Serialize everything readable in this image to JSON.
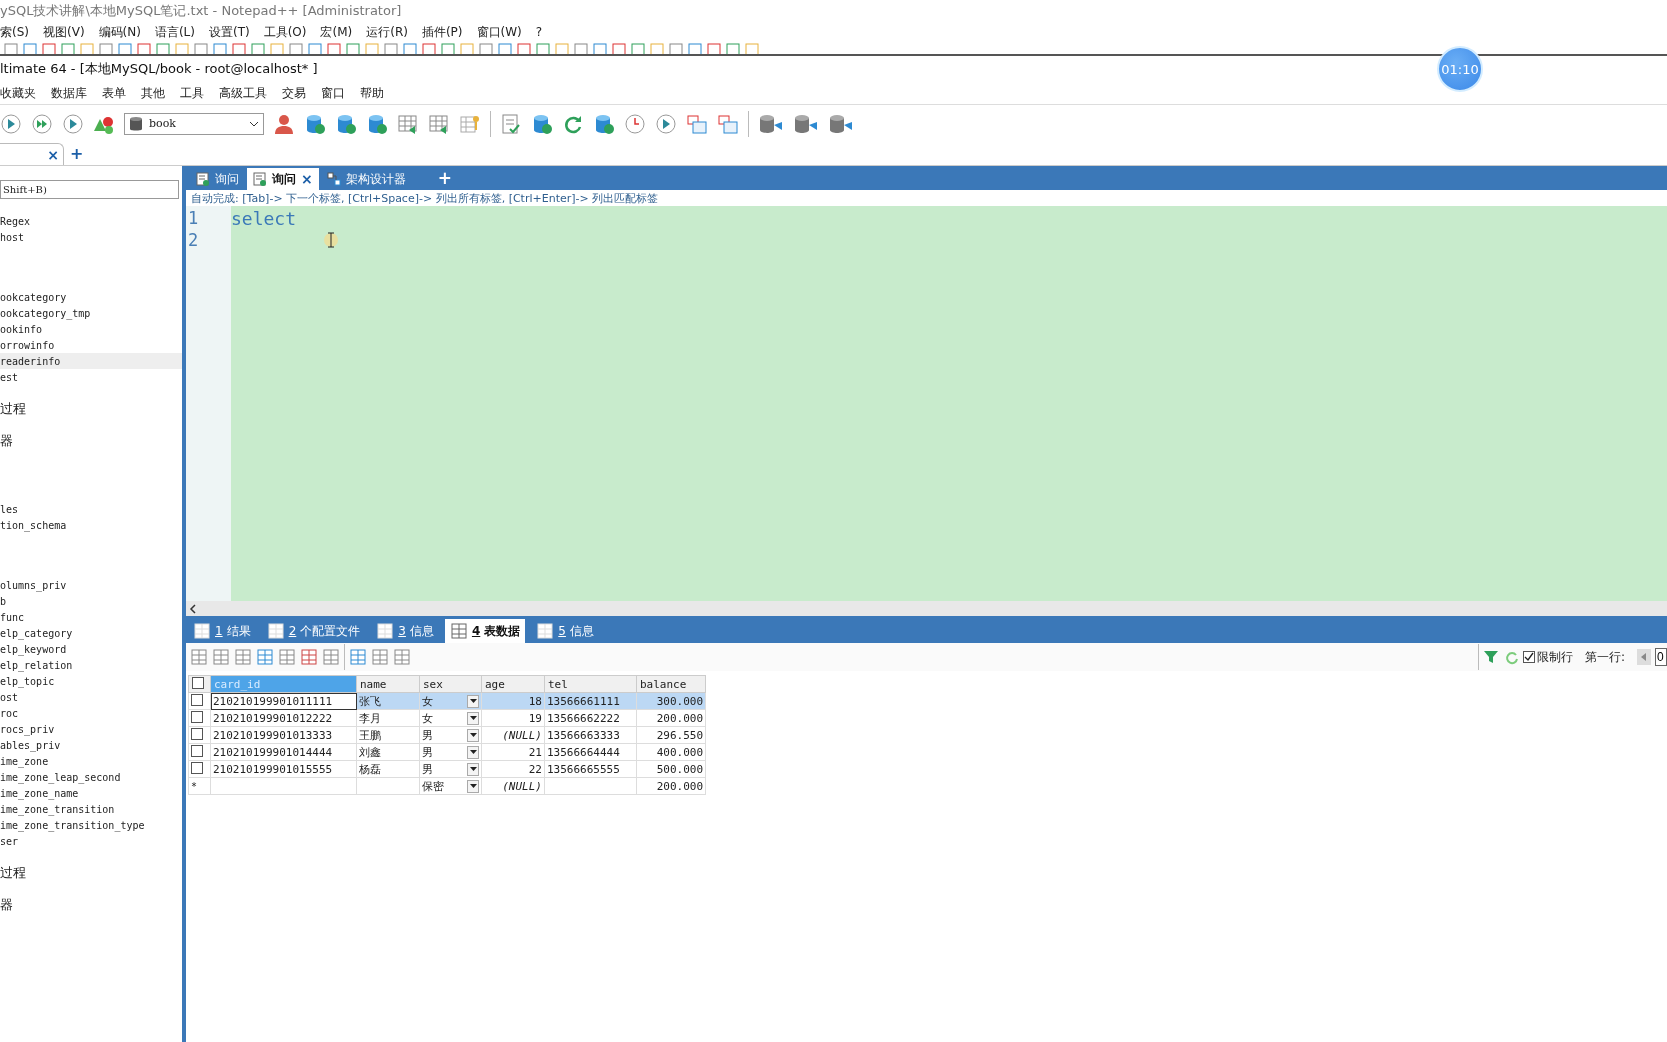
{
  "notepad": {
    "title": "ySQL技术讲解\\本地MySQL笔记.txt - Notepad++ [Administrator]",
    "menu": [
      "索(S)",
      "视图(V)",
      "编码(N)",
      "语言(L)",
      "设置(T)",
      "工具(O)",
      "宏(M)",
      "运行(R)",
      "插件(P)",
      "窗口(W)",
      "?"
    ]
  },
  "timer": {
    "text": "01:10"
  },
  "window": {
    "title": "ltimate 64 - [本地MySQL/book - root@localhost* ]"
  },
  "menu": [
    "收藏夹",
    "数据库",
    "表单",
    "其他",
    "工具",
    "高级工具",
    "交易",
    "窗口",
    "帮助"
  ],
  "toolbar": {
    "database": "book"
  },
  "connection_tabs": [
    {
      "close": "×",
      "selected": true
    }
  ],
  "new_connection_tab": "+",
  "sidebar": {
    "filter": {
      "placeholder": "Shift+B)"
    },
    "groups": [
      {
        "items": [
          {
            "kind": "item",
            "label": "Regex",
            "selected": false
          },
          {
            "kind": "item",
            "label": "host",
            "selected": false
          }
        ]
      },
      {
        "items": [
          {
            "kind": "item",
            "label": "ookcategory",
            "selected": false
          },
          {
            "kind": "item",
            "label": "ookcategory_tmp",
            "selected": false
          },
          {
            "kind": "item",
            "label": "ookinfo",
            "selected": false
          },
          {
            "kind": "item",
            "label": "orrowinfo",
            "selected": false
          },
          {
            "kind": "item",
            "label": "readerinfo",
            "selected": true
          },
          {
            "kind": "item",
            "label": "est",
            "selected": false
          }
        ]
      },
      {
        "items": [
          {
            "kind": "folder",
            "label": "过程",
            "selected": false
          },
          {
            "kind": "folder",
            "label": "器",
            "selected": false
          }
        ]
      },
      {
        "items": [
          {
            "kind": "item",
            "label": "les",
            "selected": false
          },
          {
            "kind": "item",
            "label": "tion_schema",
            "selected": false
          }
        ]
      },
      {
        "items": [
          {
            "kind": "item",
            "label": "olumns_priv",
            "selected": false
          },
          {
            "kind": "item",
            "label": "b",
            "selected": false
          },
          {
            "kind": "item",
            "label": "func",
            "selected": false
          },
          {
            "kind": "item",
            "label": "elp_category",
            "selected": false
          },
          {
            "kind": "item",
            "label": "elp_keyword",
            "selected": false
          },
          {
            "kind": "item",
            "label": "elp_relation",
            "selected": false
          },
          {
            "kind": "item",
            "label": "elp_topic",
            "selected": false
          },
          {
            "kind": "item",
            "label": "ost",
            "selected": false
          },
          {
            "kind": "item",
            "label": "roc",
            "selected": false
          },
          {
            "kind": "item",
            "label": "rocs_priv",
            "selected": false
          },
          {
            "kind": "item",
            "label": "ables_priv",
            "selected": false
          },
          {
            "kind": "item",
            "label": "ime_zone",
            "selected": false
          },
          {
            "kind": "item",
            "label": "ime_zone_leap_second",
            "selected": false
          },
          {
            "kind": "item",
            "label": "ime_zone_name",
            "selected": false
          },
          {
            "kind": "item",
            "label": "ime_zone_transition",
            "selected": false
          },
          {
            "kind": "item",
            "label": "ime_zone_transition_type",
            "selected": false
          },
          {
            "kind": "item",
            "label": "ser",
            "selected": false
          }
        ]
      },
      {
        "items": [
          {
            "kind": "folder",
            "label": "过程",
            "selected": false
          },
          {
            "kind": "folder",
            "label": "器",
            "selected": false
          }
        ]
      }
    ]
  },
  "editor_tabs": [
    {
      "label": "询问",
      "selected": false
    },
    {
      "label": "询问",
      "selected": true,
      "close": "×"
    },
    {
      "label": "架构设计器",
      "selected": false
    }
  ],
  "add_tab": "+",
  "hint": "自动完成: [Tab]-> 下一个标签, [Ctrl+Space]-> 列出所有标签, [Ctrl+Enter]-> 列出匹配标签",
  "editor": {
    "lines": [
      {
        "number": "1",
        "code": "select"
      },
      {
        "number": "2"
      }
    ]
  },
  "result_tabs": [
    {
      "number": "1",
      "label": "结果",
      "selected": false
    },
    {
      "number": "2",
      "label": "个配置文件",
      "selected": false
    },
    {
      "number": "3",
      "label": "信息",
      "selected": false
    },
    {
      "number": "4",
      "label": "表数据",
      "selected": true
    },
    {
      "number": "5",
      "label": "信息",
      "selected": false
    }
  ],
  "result_toolbar": {
    "limit_rows": {
      "label": "限制行",
      "checked": true
    },
    "first_row": {
      "label": "第一行:",
      "value": "0"
    }
  },
  "table": {
    "select_all": {
      "checked": false
    },
    "columns": [
      {
        "label": "card_id",
        "selected": true
      },
      {
        "label": "name",
        "selected": false
      },
      {
        "label": "sex",
        "selected": false
      },
      {
        "label": "age",
        "selected": false
      },
      {
        "label": "tel",
        "selected": false
      },
      {
        "label": "balance",
        "selected": false
      }
    ],
    "rows": [
      {
        "kind": "data",
        "selected": true,
        "checked": false,
        "cells": [
          {
            "kind": "text",
            "text": "210210199901011111"
          },
          {
            "kind": "text",
            "text": "张飞"
          },
          {
            "kind": "enum",
            "text": "女"
          },
          {
            "kind": "number",
            "text": "18"
          },
          {
            "kind": "text",
            "text": "13566661111"
          },
          {
            "kind": "number",
            "text": "300.000"
          }
        ]
      },
      {
        "kind": "data",
        "selected": false,
        "checked": false,
        "cells": [
          {
            "kind": "text",
            "text": "210210199901012222"
          },
          {
            "kind": "text",
            "text": "李月"
          },
          {
            "kind": "enum",
            "text": "女"
          },
          {
            "kind": "number",
            "text": "19"
          },
          {
            "kind": "text",
            "text": "13566662222"
          },
          {
            "kind": "number",
            "text": "200.000"
          }
        ]
      },
      {
        "kind": "data",
        "selected": false,
        "checked": false,
        "cells": [
          {
            "kind": "text",
            "text": "210210199901013333"
          },
          {
            "kind": "text",
            "text": "王鹏"
          },
          {
            "kind": "enum",
            "text": "男"
          },
          {
            "kind": "null",
            "text": "(NULL)"
          },
          {
            "kind": "text",
            "text": "13566663333"
          },
          {
            "kind": "number",
            "text": "296.550"
          }
        ]
      },
      {
        "kind": "data",
        "selected": false,
        "checked": false,
        "cells": [
          {
            "kind": "text",
            "text": "210210199901014444"
          },
          {
            "kind": "text",
            "text": "刘鑫"
          },
          {
            "kind": "enum",
            "text": "男"
          },
          {
            "kind": "number",
            "text": "21"
          },
          {
            "kind": "text",
            "text": "13566664444"
          },
          {
            "kind": "number",
            "text": "400.000"
          }
        ]
      },
      {
        "kind": "data",
        "selected": false,
        "checked": false,
        "cells": [
          {
            "kind": "text",
            "text": "210210199901015555"
          },
          {
            "kind": "text",
            "text": "杨磊"
          },
          {
            "kind": "enum",
            "text": "男"
          },
          {
            "kind": "number",
            "text": "22"
          },
          {
            "kind": "text",
            "text": "13566665555"
          },
          {
            "kind": "number",
            "text": "500.000"
          }
        ]
      },
      {
        "kind": "new",
        "marker": "*",
        "selected": false,
        "cells": [
          null,
          null,
          {
            "kind": "enum",
            "text": "保密"
          },
          {
            "kind": "null",
            "text": "(NULL)"
          },
          null,
          {
            "kind": "number",
            "text": "200.000"
          }
        ]
      }
    ]
  }
}
